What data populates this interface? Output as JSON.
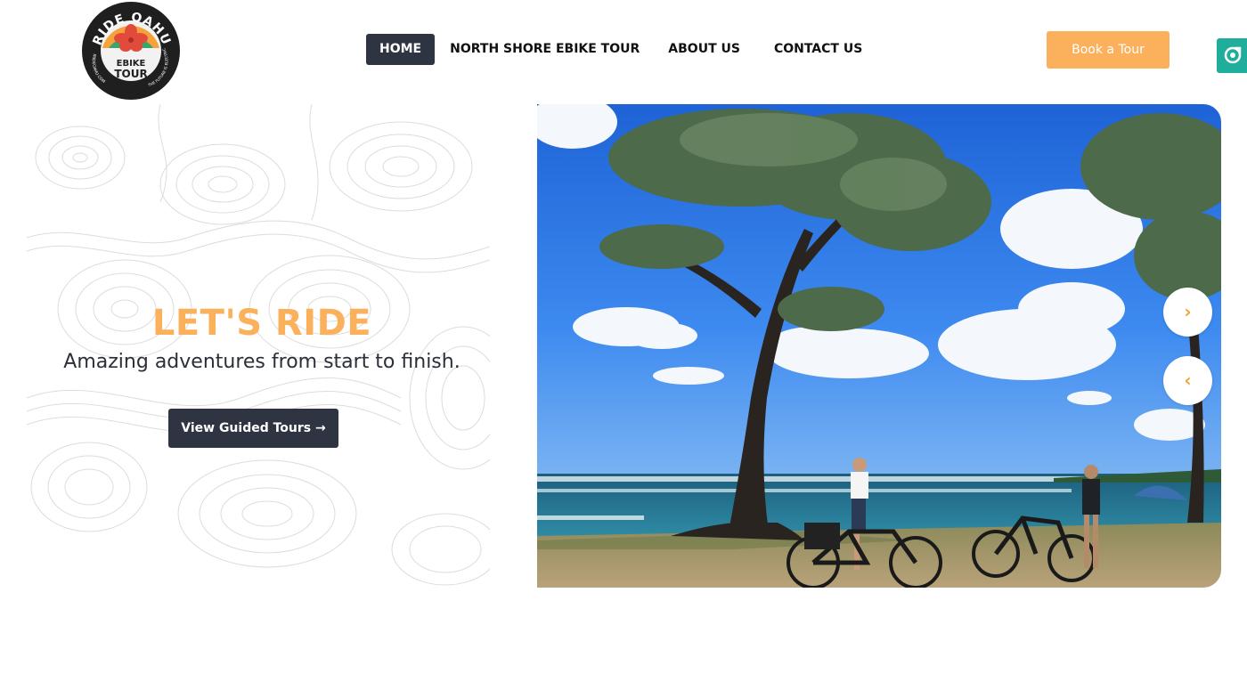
{
  "header": {
    "logo": {
      "arc_text": "RIDE OAHU",
      "center_text_1": "EBIKE",
      "center_text_2": "TOUR",
      "ring_left_text": "IRIDEOAHU.COM",
      "ring_right_text": "THE FUTURE IS ELECTRIC"
    },
    "nav": [
      {
        "label": "HOME",
        "active": true
      },
      {
        "label": "NORTH SHORE EBIKE TOUR",
        "active": false
      },
      {
        "label": "ABOUT US",
        "active": false
      },
      {
        "label": "CONTACT US",
        "active": false
      }
    ],
    "book_button": "Book a Tour"
  },
  "hero": {
    "title": "LET'S RIDE",
    "subtitle": "Amazing adventures from start to finish.",
    "cta": "View Guided Tours →"
  },
  "slider": {
    "next_icon": "chevron-right-icon",
    "prev_icon": "chevron-left-icon"
  },
  "colors": {
    "accent": "#fbb05b",
    "dark": "#2e3441",
    "widget": "#1fae9c"
  }
}
